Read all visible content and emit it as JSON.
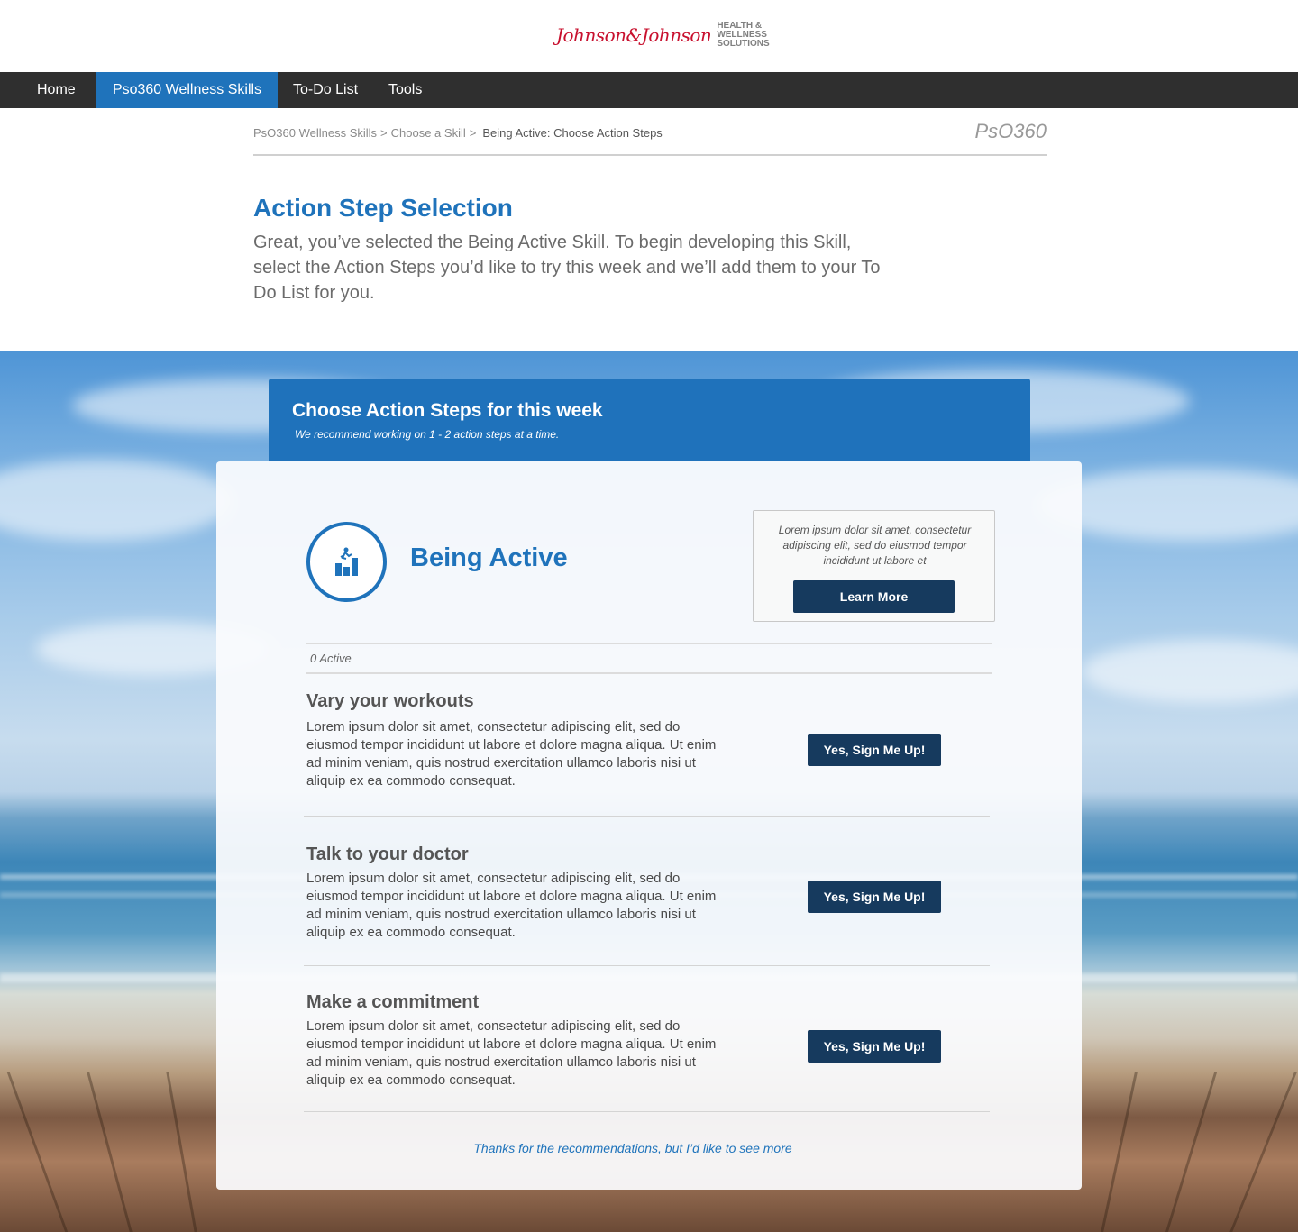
{
  "header": {
    "brand_script": "Johnson&Johnson",
    "brand_tag_lines": [
      "HEALTH &",
      "WELLNESS",
      "SOLUTIONS"
    ]
  },
  "nav": {
    "items": [
      {
        "label": "Home"
      },
      {
        "label": "Pso360 Wellness Skills"
      },
      {
        "label": "To-Do List"
      },
      {
        "label": "Tools"
      }
    ]
  },
  "breadcrumb": {
    "items": [
      "PsO360 Wellness Skills",
      "Choose a Skill"
    ],
    "separator": ">",
    "current": "Being Active: Choose Action Steps",
    "product_name": "PsO360"
  },
  "intro": {
    "title": "Action Step Selection",
    "text": "Great, you’ve selected the Being Active Skill.  To begin developing this Skill, select the Action Steps you’d like to try this week and we’ll add them to your To Do List for you."
  },
  "panel": {
    "title": "Choose Action Steps for this week",
    "subtitle": "We recommend working on 1 - 2 action steps at a time."
  },
  "skill": {
    "title": "Being Active",
    "icon": "climbing-chart-icon",
    "info_text": "Lorem ipsum dolor sit amet, consectetur adipiscing elit, sed do eiusmod tempor incididunt ut labore et",
    "learn_more_label": "Learn More",
    "active_count_label": "0 Active"
  },
  "steps": [
    {
      "title": "Vary your workouts",
      "description": "Lorem ipsum dolor sit amet, consectetur adipiscing elit, sed do eiusmod tempor incididunt ut labore et dolore magna aliqua. Ut enim ad minim veniam, quis nostrud exercitation ullamco laboris nisi ut aliquip ex ea commodo consequat.",
      "button_label": "Yes, Sign Me Up!"
    },
    {
      "title": "Talk to your doctor",
      "description": "Lorem ipsum dolor sit amet, consectetur adipiscing elit, sed do eiusmod tempor incididunt ut labore et dolore magna aliqua. Ut enim ad minim veniam, quis nostrud exercitation ullamco laboris nisi ut aliquip ex ea commodo consequat.",
      "button_label": "Yes, Sign Me Up!"
    },
    {
      "title": "Make a commitment",
      "description": "Lorem ipsum dolor sit amet, consectetur adipiscing elit, sed do eiusmod tempor incididunt ut labore et dolore magna aliqua. Ut enim ad minim veniam, quis nostrud exercitation ullamco laboris nisi ut aliquip ex ea commodo consequat.",
      "button_label": "Yes, Sign Me Up!"
    }
  ],
  "footer_link": "Thanks for the recommendations, but I’d like to see more",
  "colors": {
    "primary_blue": "#1f73bb",
    "button_navy": "#163a5e",
    "nav_dark": "#2f2f2f",
    "brand_red": "#c8102e"
  }
}
